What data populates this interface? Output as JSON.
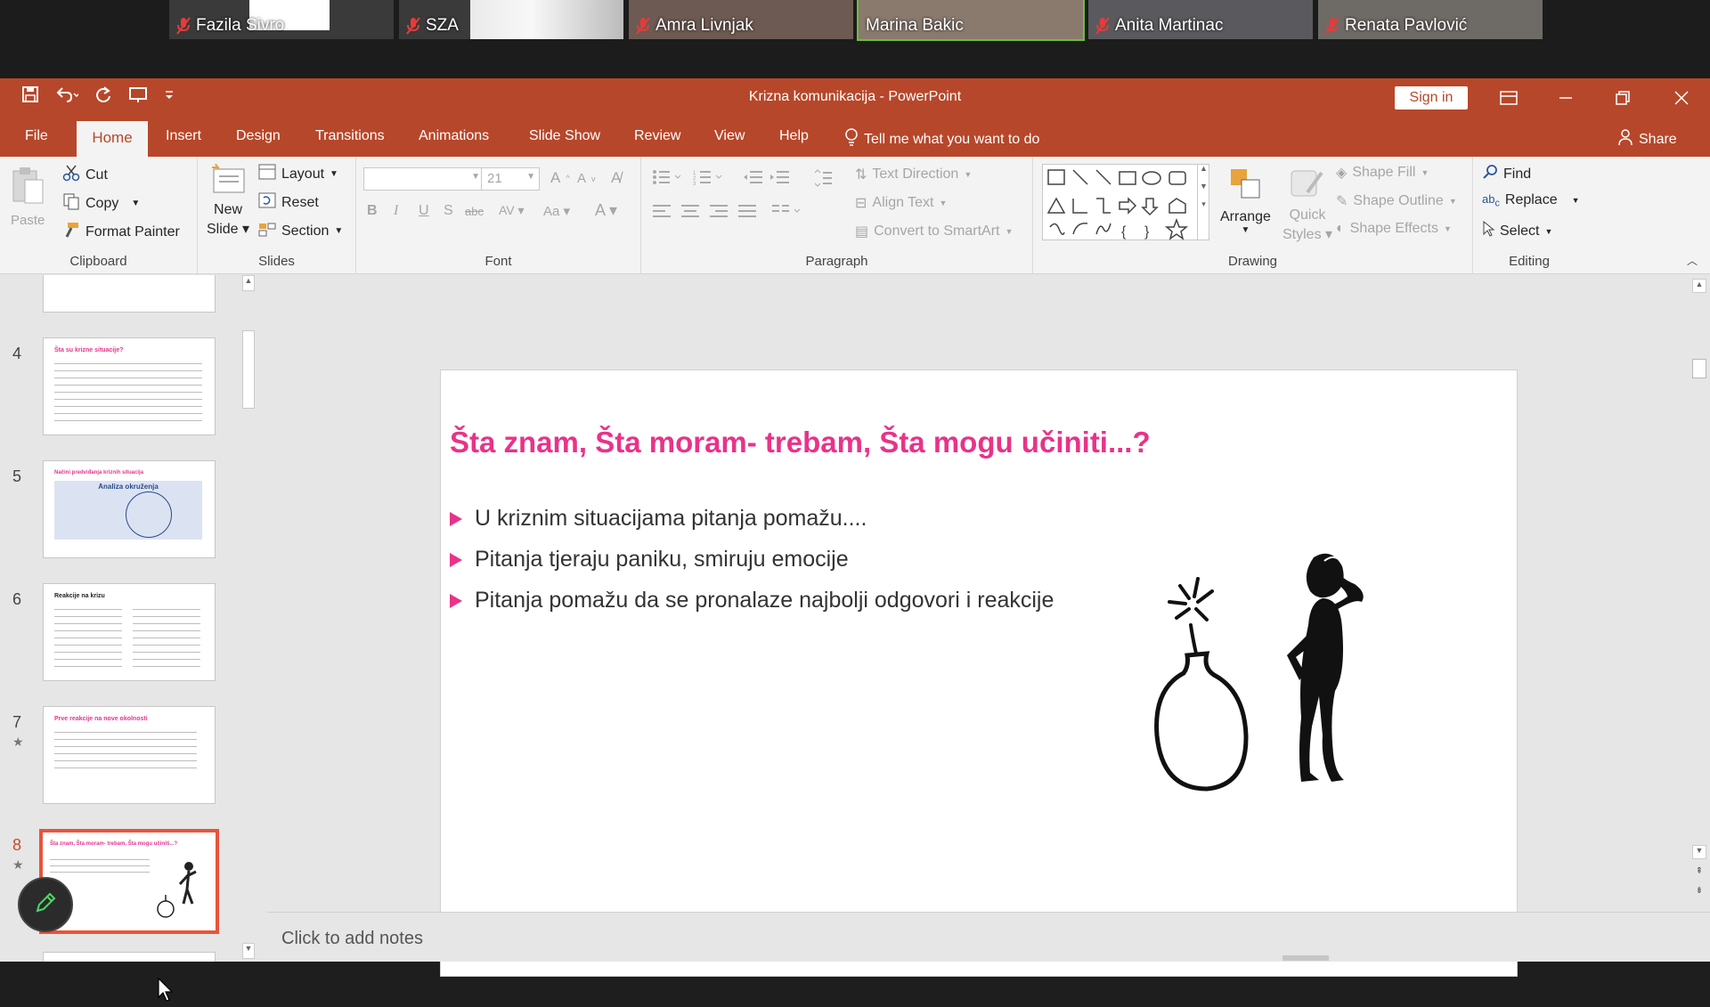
{
  "zoom": {
    "participants": [
      {
        "name": "Fazila Sivro",
        "muted": true
      },
      {
        "name": "SZA",
        "muted": true
      },
      {
        "name": "Amra Livnjak",
        "muted": true
      },
      {
        "name": "Marina Bakic",
        "muted": false,
        "active": true
      },
      {
        "name": "Anita Martinac",
        "muted": true
      },
      {
        "name": "Renata Pavlović",
        "muted": true
      }
    ]
  },
  "titlebar": {
    "doc_title": "Krizna komunikacija  -  PowerPoint",
    "sign_in": "Sign in"
  },
  "tabs": {
    "file": "File",
    "home": "Home",
    "insert": "Insert",
    "design": "Design",
    "transitions": "Transitions",
    "animations": "Animations",
    "slideshow": "Slide Show",
    "review": "Review",
    "view": "View",
    "help": "Help",
    "tellme": "Tell me what you want to do",
    "share": "Share"
  },
  "ribbon": {
    "clipboard": {
      "label": "Clipboard",
      "paste": "Paste",
      "cut": "Cut",
      "copy": "Copy",
      "format_painter": "Format Painter"
    },
    "slides": {
      "label": "Slides",
      "new_slide_1": "New",
      "new_slide_2": "Slide",
      "layout": "Layout",
      "reset": "Reset",
      "section": "Section"
    },
    "font": {
      "label": "Font",
      "size": "21"
    },
    "paragraph": {
      "label": "Paragraph",
      "text_direction": "Text Direction",
      "align_text": "Align Text",
      "convert_smartart": "Convert to SmartArt"
    },
    "drawing": {
      "label": "Drawing",
      "arrange": "Arrange",
      "quick_styles_1": "Quick",
      "quick_styles_2": "Styles",
      "shape_fill": "Shape Fill",
      "shape_outline": "Shape Outline",
      "shape_effects": "Shape Effects"
    },
    "editing": {
      "label": "Editing",
      "find": "Find",
      "replace": "Replace",
      "select": "Select"
    }
  },
  "thumbnails": [
    {
      "num": "4",
      "star": false,
      "title": "Šta su krizne situacije?"
    },
    {
      "num": "5",
      "star": false,
      "title": "Načini predviđanja kriznih situacija",
      "subtitle": "Analiza okruženja"
    },
    {
      "num": "6",
      "star": false,
      "title": "Reakcije na krizu"
    },
    {
      "num": "7",
      "star": true,
      "title": "Prve reakcije na nove okolnosti"
    },
    {
      "num": "8",
      "star": true,
      "title": "Šta znam, Šta moram- trebam, Šta mogu učiniti...?",
      "selected": true
    }
  ],
  "slide": {
    "title": "Šta znam, Šta moram- trebam, Šta mogu učiniti...?",
    "bullets": [
      "U kriznim situacijama pitanja pomažu....",
      "Pitanja tjeraju paniku, smiruju emocije",
      "Pitanja pomažu da se pronalaze najbolji odgovori i reakcije"
    ]
  },
  "notes": {
    "placeholder": "Click to add notes"
  },
  "colors": {
    "accent": "#b7472a",
    "title_pink": "#e8338a"
  }
}
